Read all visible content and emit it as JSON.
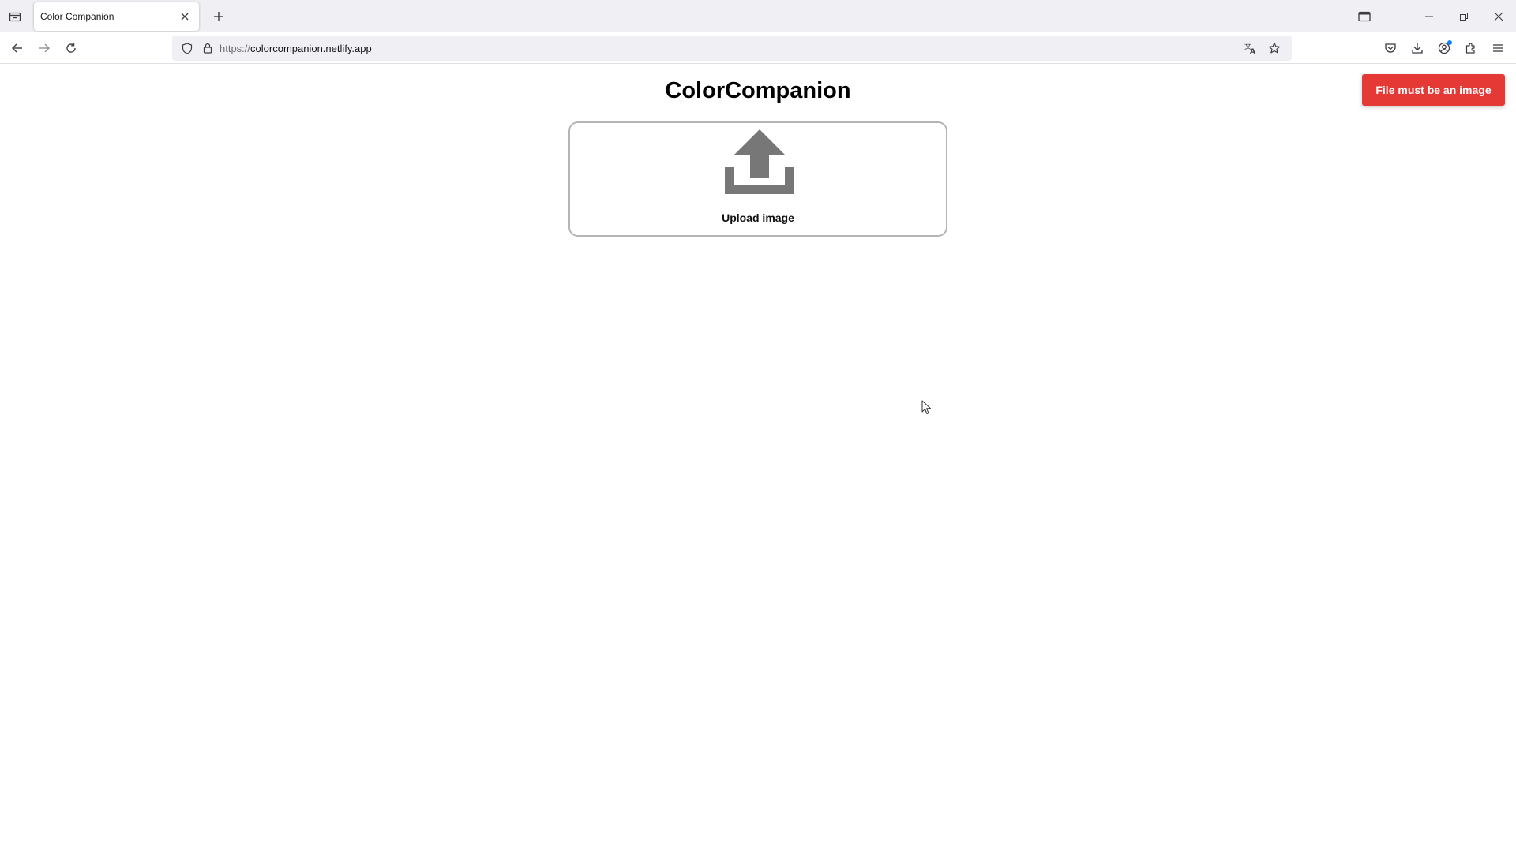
{
  "browser": {
    "tab": {
      "title": "Color Companion"
    },
    "address": {
      "protocol": "https://",
      "host": "colorcompanion.netlify.app"
    }
  },
  "page": {
    "title": "ColorCompanion",
    "upload": {
      "label": "Upload image",
      "icon": "upload-icon"
    },
    "toast": {
      "message": "File must be an image",
      "color": "#e53935"
    }
  },
  "colors": {
    "chrome_bg": "#f0f0f4",
    "icon_gray": "#777777",
    "dropzone_border": "#b5b5b5"
  }
}
